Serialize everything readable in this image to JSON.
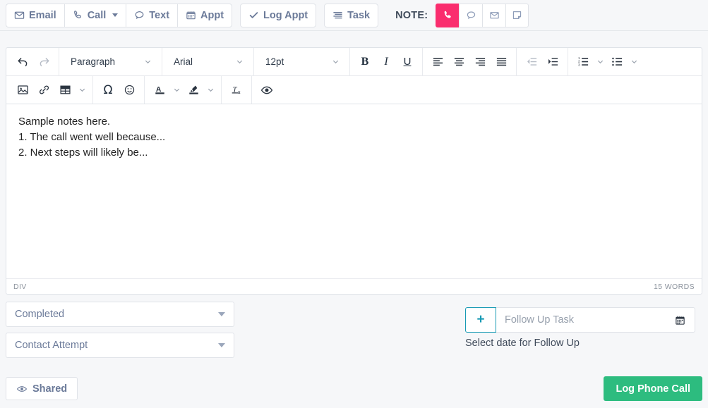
{
  "topbar": {
    "actions": [
      {
        "label": "Email",
        "icon": "envelope-icon",
        "caret": false
      },
      {
        "label": "Call",
        "icon": "phone-icon",
        "caret": true
      },
      {
        "label": "Text",
        "icon": "chat-bubble-icon",
        "caret": false
      },
      {
        "label": "Appt",
        "icon": "calendar-icon",
        "caret": false
      }
    ],
    "log_appt_label": "Log Appt",
    "task_label": "Task",
    "note_label": "NOTE:",
    "note_types": [
      {
        "name": "note-type-phone",
        "icon": "phone-icon",
        "active": true
      },
      {
        "name": "note-type-text",
        "icon": "chat-bubble-icon",
        "active": false
      },
      {
        "name": "note-type-email",
        "icon": "envelope-icon",
        "active": false
      },
      {
        "name": "note-type-note",
        "icon": "note-page-icon",
        "active": false
      }
    ],
    "active_color": "#fa2d6e"
  },
  "editor": {
    "undo_label": "Undo",
    "redo_label": "Redo",
    "block_format": "Paragraph",
    "font_family": "Arial",
    "font_size": "12pt",
    "bold_label": "B",
    "italic_label": "I",
    "underline_label": "U",
    "clear_format_label": "Tx",
    "special_char_label": "Ω",
    "text_color_label": "A",
    "content_lines": [
      "Sample notes here.",
      "1. The call went well because...",
      "2. Next steps will likely be..."
    ],
    "status_element": "DIV",
    "status_words": "15 WORDS"
  },
  "form": {
    "status_select": "Completed",
    "type_select": "Contact Attempt",
    "followup": {
      "add_label": "+",
      "placeholder": "Follow Up Task",
      "help_text": "Select date for Follow Up",
      "accent_color": "#189ab4"
    }
  },
  "footer": {
    "shared_label": "Shared",
    "submit_label": "Log Phone Call",
    "submit_color": "#2dbc7f"
  }
}
